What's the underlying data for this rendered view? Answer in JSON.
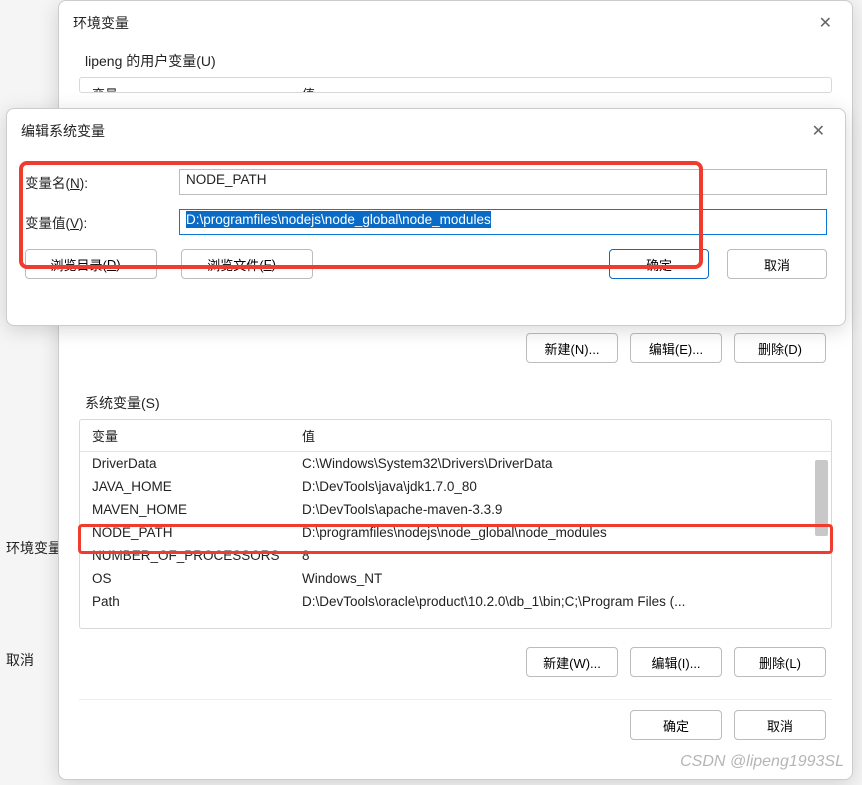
{
  "envDialog": {
    "title": "环境变量",
    "userGroup": "lipeng 的用户变量(U)",
    "sysGroup": "系统变量(S)",
    "headers": {
      "var": "变量",
      "val": "值"
    },
    "sysVars": [
      {
        "name": "DriverData",
        "value": "C:\\Windows\\System32\\Drivers\\DriverData"
      },
      {
        "name": "JAVA_HOME",
        "value": "D:\\DevTools\\java\\jdk1.7.0_80"
      },
      {
        "name": "MAVEN_HOME",
        "value": "D:\\DevTools\\apache-maven-3.3.9"
      },
      {
        "name": "NODE_PATH",
        "value": "D:\\programfiles\\nodejs\\node_global\\node_modules"
      },
      {
        "name": "NUMBER_OF_PROCESSORS",
        "value": "8"
      },
      {
        "name": "OS",
        "value": "Windows_NT"
      },
      {
        "name": "Path",
        "value": "D:\\DevTools\\oracle\\product\\10.2.0\\db_1\\bin;C;\\Program Files (..."
      }
    ],
    "userButtons": {
      "new": "新建(N)...",
      "edit": "编辑(E)...",
      "delete": "删除(D)"
    },
    "sysButtons": {
      "new": "新建(W)...",
      "edit": "编辑(I)...",
      "delete": "删除(L)"
    },
    "footer": {
      "ok": "确定",
      "cancel": "取消"
    }
  },
  "editDialog": {
    "title": "编辑系统变量",
    "nameLabelPrefix": "变量名(",
    "nameLabelKey": "N",
    "nameLabelSuffix": "):",
    "nameValue": "NODE_PATH",
    "valueLabelPrefix": "变量值(",
    "valueLabelKey": "V",
    "valueLabelSuffix": "):",
    "valueValue": "D:\\programfiles\\nodejs\\node_global\\node_modules",
    "browseDirPrefix": "浏览目录(",
    "browseDirKey": "D",
    "browseDirSuffix": ")...",
    "browseFilePrefix": "浏览文件(",
    "browseFileKey": "F",
    "browseFileSuffix": ")...",
    "ok": "确定",
    "cancel": "取消"
  },
  "side": {
    "envLabel": "环境变量",
    "cancel": "取消"
  },
  "watermark": "CSDN @lipeng1993SL"
}
